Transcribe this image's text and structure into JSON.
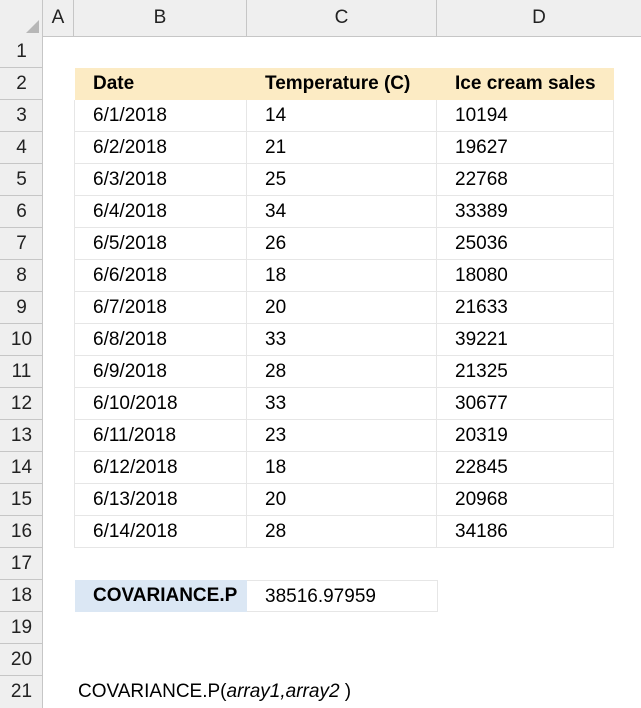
{
  "columns": [
    "A",
    "B",
    "C",
    "D"
  ],
  "rows": [
    "1",
    "2",
    "3",
    "4",
    "5",
    "6",
    "7",
    "8",
    "9",
    "10",
    "11",
    "12",
    "13",
    "14",
    "15",
    "16",
    "17",
    "18",
    "19",
    "20",
    "21"
  ],
  "table": {
    "headers": [
      "Date",
      "Temperature (C)",
      "Ice cream sales"
    ],
    "rows": [
      [
        "6/1/2018",
        "14",
        "10194"
      ],
      [
        "6/2/2018",
        "21",
        "19627"
      ],
      [
        "6/3/2018",
        "25",
        "22768"
      ],
      [
        "6/4/2018",
        "34",
        "33389"
      ],
      [
        "6/5/2018",
        "26",
        "25036"
      ],
      [
        "6/6/2018",
        "18",
        "18080"
      ],
      [
        "6/7/2018",
        "20",
        "21633"
      ],
      [
        "6/8/2018",
        "33",
        "39221"
      ],
      [
        "6/9/2018",
        "28",
        "21325"
      ],
      [
        "6/10/2018",
        "33",
        "30677"
      ],
      [
        "6/11/2018",
        "23",
        "20319"
      ],
      [
        "6/12/2018",
        "18",
        "22845"
      ],
      [
        "6/13/2018",
        "20",
        "20968"
      ],
      [
        "6/14/2018",
        "28",
        "34186"
      ]
    ]
  },
  "result": {
    "label": "COVARIANCE.P",
    "value": "38516.97959"
  },
  "syntax": {
    "func": "COVARIANCE.P(",
    "arg1": "array1",
    "sep": ",",
    "arg2": "array2",
    "close": " )"
  },
  "colors": {
    "header_fill": "#fcebc4",
    "result_label_fill": "#dbe7f4"
  }
}
